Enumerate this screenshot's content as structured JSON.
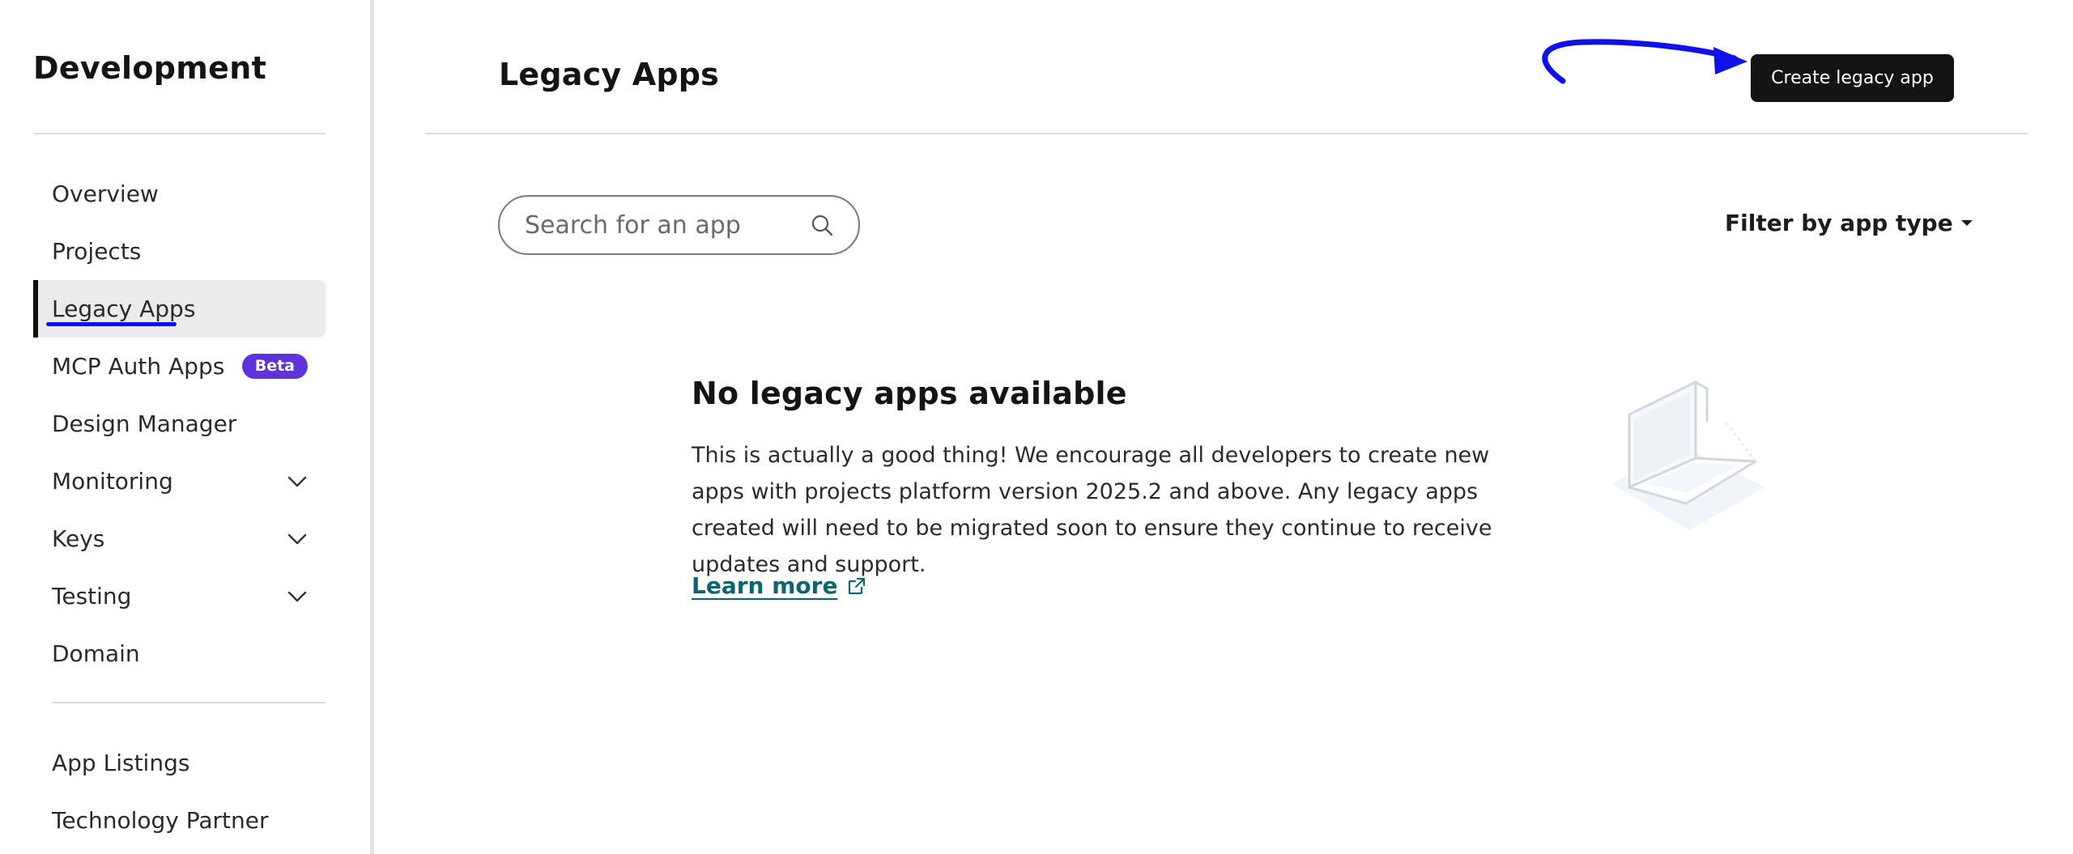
{
  "sidebar": {
    "title": "Development",
    "nav_items": [
      {
        "label": "Overview"
      },
      {
        "label": "Projects"
      },
      {
        "label": "Legacy Apps",
        "active": true
      },
      {
        "label": "MCP Auth Apps",
        "badge": "Beta"
      },
      {
        "label": "Design Manager"
      },
      {
        "label": "Monitoring",
        "icon": "chevron-down-icon"
      },
      {
        "label": "Keys",
        "icon": "chevron-down-icon"
      },
      {
        "label": "Testing",
        "icon": "chevron-down-icon"
      },
      {
        "label": "Domain"
      }
    ],
    "secondary_items": [
      {
        "label": "App Listings"
      },
      {
        "label": "Technology Partner"
      }
    ]
  },
  "header": {
    "title": "Legacy Apps",
    "create_button_label": "Create legacy app"
  },
  "search": {
    "placeholder": "Search for an app",
    "icon": "search-icon"
  },
  "filter": {
    "label": "Filter by app type",
    "icon": "caret-down-icon"
  },
  "empty_state": {
    "title": "No legacy apps available",
    "description": "This is actually a good thing! We encourage all developers to create new apps with projects platform version 2025.2 and above. Any legacy apps created will need to be migrated soon to ensure they continue to receive updates and support.",
    "link_label": "Learn more",
    "link_icon": "external-link-icon",
    "illustration": "laptop-illustration"
  },
  "colors": {
    "accent_badge": "#5e33d9",
    "link": "#0b6670",
    "annotation": "#1010e8",
    "primary_button": "#141414"
  }
}
